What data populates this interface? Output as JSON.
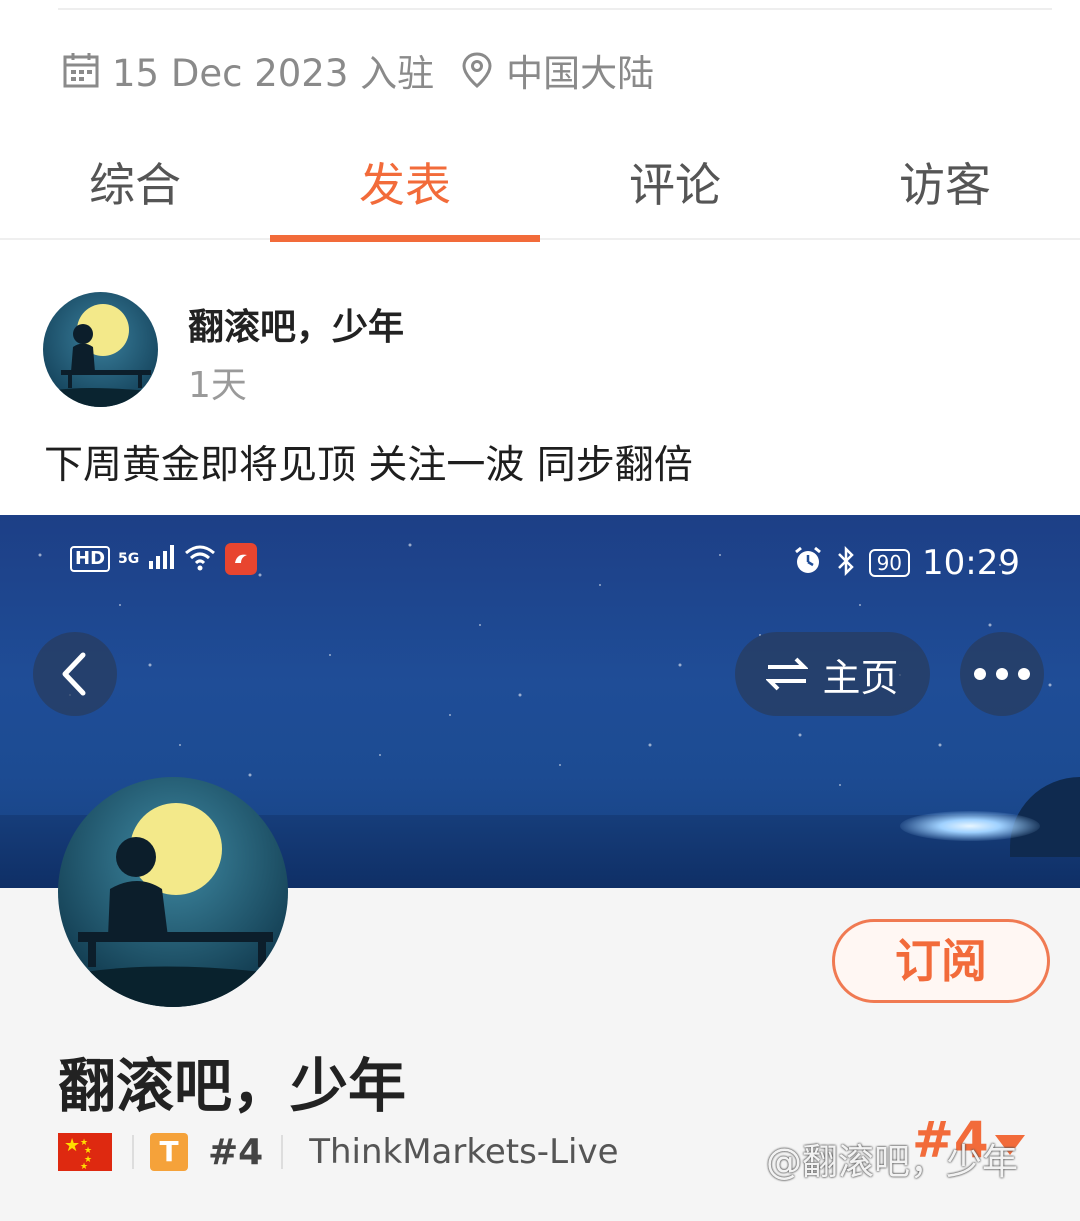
{
  "profile_meta": {
    "join_date": "15 Dec 2023 入驻",
    "location": "中国大陆"
  },
  "tabs": [
    {
      "label": "综合",
      "active": false
    },
    {
      "label": "发表",
      "active": true
    },
    {
      "label": "评论",
      "active": false
    },
    {
      "label": "访客",
      "active": false
    }
  ],
  "post": {
    "author": "翻滚吧，少年",
    "time": "1天",
    "text": "下周黄金即将见顶 关注一波 同步翻倍"
  },
  "screenshot": {
    "status_bar": {
      "hd": "HD",
      "network": "5G",
      "battery": "90",
      "clock": "10:29"
    },
    "home_button": "主页",
    "subscribe_button": "订阅",
    "profile_name": "翻滚吧，少年",
    "t_badge": "T",
    "rank": "#4",
    "broker": "ThinkMarkets-Live",
    "rank_big": "#4",
    "watermark": "@翻滚吧，少年"
  },
  "colors": {
    "accent": "#f26b3a",
    "sky": "#1f4d97",
    "moon": "#f3e98a"
  },
  "icons": [
    "calendar-icon",
    "location-pin-icon",
    "back-chevron-icon",
    "swap-arrows-icon",
    "more-dots-icon",
    "alarm-icon",
    "bluetooth-icon",
    "signal-icon",
    "wifi-icon",
    "china-flag-icon",
    "rank-arrow-icon"
  ]
}
